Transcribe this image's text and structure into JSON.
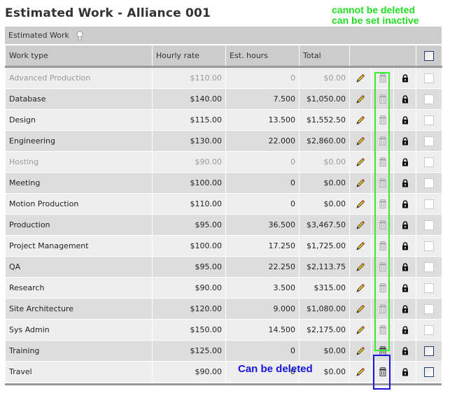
{
  "page": {
    "title": "Estimated Work - Alliance 001"
  },
  "section": {
    "caption": "Estimated Work",
    "caption_icon": "lightbulb-icon"
  },
  "table": {
    "columns": [
      "Work type",
      "Hourly rate",
      "Est. hours",
      "Total",
      "",
      "",
      "",
      ""
    ],
    "rows": [
      {
        "work_type": "Advanced Production",
        "hourly_rate": "$110.00",
        "est_hours": "0",
        "total": "$0.00",
        "inactive": true,
        "deletable": false
      },
      {
        "work_type": "Database",
        "hourly_rate": "$140.00",
        "est_hours": "7.500",
        "total": "$1,050.00",
        "inactive": false,
        "deletable": false
      },
      {
        "work_type": "Design",
        "hourly_rate": "$115.00",
        "est_hours": "13.500",
        "total": "$1,552.50",
        "inactive": false,
        "deletable": false
      },
      {
        "work_type": "Engineering",
        "hourly_rate": "$130.00",
        "est_hours": "22.000",
        "total": "$2,860.00",
        "inactive": false,
        "deletable": false
      },
      {
        "work_type": "Hosting",
        "hourly_rate": "$90.00",
        "est_hours": "0",
        "total": "$0.00",
        "inactive": true,
        "deletable": false
      },
      {
        "work_type": "Meeting",
        "hourly_rate": "$100.00",
        "est_hours": "0",
        "total": "$0.00",
        "inactive": false,
        "deletable": false
      },
      {
        "work_type": "Motion Production",
        "hourly_rate": "$110.00",
        "est_hours": "0",
        "total": "$0.00",
        "inactive": false,
        "deletable": false
      },
      {
        "work_type": "Production",
        "hourly_rate": "$95.00",
        "est_hours": "36.500",
        "total": "$3,467.50",
        "inactive": false,
        "deletable": false
      },
      {
        "work_type": "Project Management",
        "hourly_rate": "$100.00",
        "est_hours": "17.250",
        "total": "$1,725.00",
        "inactive": false,
        "deletable": false
      },
      {
        "work_type": "QA",
        "hourly_rate": "$95.00",
        "est_hours": "22.250",
        "total": "$2,113.75",
        "inactive": false,
        "deletable": false
      },
      {
        "work_type": "Research",
        "hourly_rate": "$90.00",
        "est_hours": "3.500",
        "total": "$315.00",
        "inactive": false,
        "deletable": false
      },
      {
        "work_type": "Site Architecture",
        "hourly_rate": "$120.00",
        "est_hours": "9.000",
        "total": "$1,080.00",
        "inactive": false,
        "deletable": false
      },
      {
        "work_type": "Sys Admin",
        "hourly_rate": "$150.00",
        "est_hours": "14.500",
        "total": "$2,175.00",
        "inactive": false,
        "deletable": false
      },
      {
        "work_type": "Training",
        "hourly_rate": "$125.00",
        "est_hours": "0",
        "total": "$0.00",
        "inactive": false,
        "deletable": true
      },
      {
        "work_type": "Travel",
        "hourly_rate": "$90.00",
        "est_hours": "0",
        "total": "$0.00",
        "inactive": false,
        "deletable": true
      }
    ],
    "row_icons": [
      "pencil-icon",
      "trash-icon",
      "lock-icon",
      "checkbox"
    ]
  },
  "annotations": {
    "green_line1": "cannot be deleted",
    "green_line2": "can be set inactive",
    "blue": "Can be deleted",
    "green_color": "#33ee33",
    "blue_color": "#1515dd"
  }
}
